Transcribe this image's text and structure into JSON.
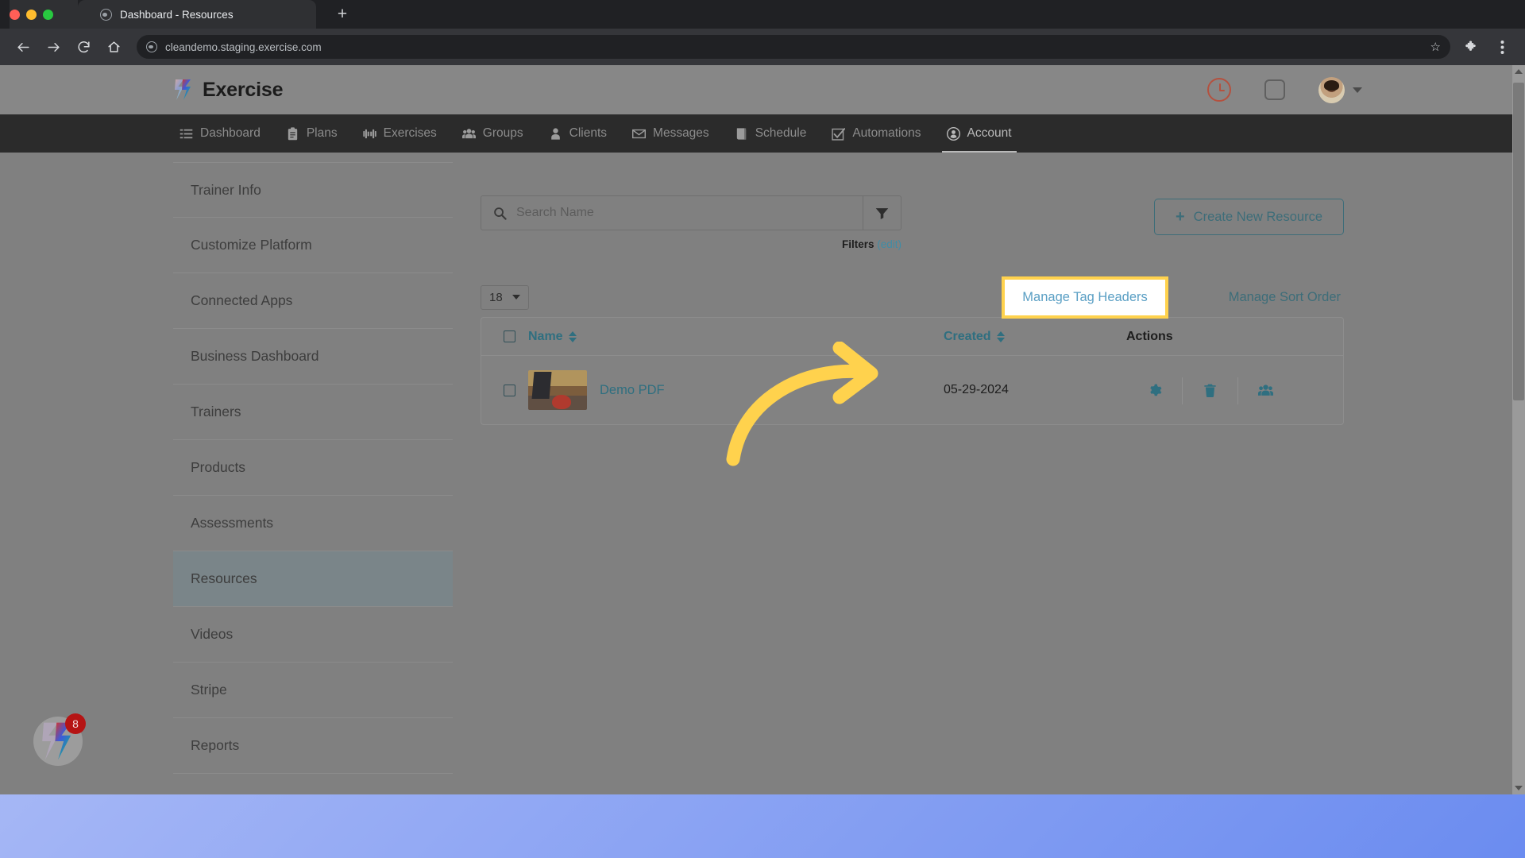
{
  "browser": {
    "tab": {
      "title": "Dashboard - Resources",
      "favicon_icon": "globe-icon"
    },
    "new_tab_label": "+",
    "back_icon": "back-arrow-icon",
    "forward_icon": "forward-arrow-icon",
    "reload_icon": "reload-icon",
    "home_icon": "home-icon",
    "url": "cleandemo.staging.exercise.com",
    "star_icon": "star-icon",
    "extensions_icon": "puzzle-piece-icon",
    "menu_icon": "three-dot-menu-icon"
  },
  "site_header": {
    "brand_name": "Exercise",
    "logo_icon": "chevron-logo-icon",
    "clock_icon": "clock-icon",
    "square_icon": "square-icon",
    "avatar_icon": "user-avatar",
    "caret_icon": "chevron-down-icon"
  },
  "main_nav": {
    "items": [
      {
        "label": "Dashboard",
        "icon": "list-icon",
        "active": false
      },
      {
        "label": "Plans",
        "icon": "clipboard-icon",
        "active": false
      },
      {
        "label": "Exercises",
        "icon": "dumbbell-icon",
        "active": false
      },
      {
        "label": "Groups",
        "icon": "people-icon",
        "active": false
      },
      {
        "label": "Clients",
        "icon": "person-icon",
        "active": false
      },
      {
        "label": "Messages",
        "icon": "envelope-icon",
        "active": false
      },
      {
        "label": "Schedule",
        "icon": "book-icon",
        "active": false
      },
      {
        "label": "Automations",
        "icon": "check-square-icon",
        "active": false
      },
      {
        "label": "Account",
        "icon": "user-circle-icon",
        "active": true
      }
    ]
  },
  "sidebar": {
    "items": [
      {
        "label": "Trainer Info",
        "active": false
      },
      {
        "label": "Customize Platform",
        "active": false
      },
      {
        "label": "Connected Apps",
        "active": false
      },
      {
        "label": "Business Dashboard",
        "active": false
      },
      {
        "label": "Trainers",
        "active": false
      },
      {
        "label": "Products",
        "active": false
      },
      {
        "label": "Assessments",
        "active": false
      },
      {
        "label": "Resources",
        "active": true
      },
      {
        "label": "Videos",
        "active": false
      },
      {
        "label": "Stripe",
        "active": false
      },
      {
        "label": "Reports",
        "active": false
      }
    ]
  },
  "main": {
    "search": {
      "placeholder": "Search Name",
      "value": "",
      "search_icon": "search-icon",
      "filter_icon": "funnel-icon"
    },
    "filters": {
      "label": "Filters",
      "edit_label": "(edit)"
    },
    "create_button": {
      "plus": "+",
      "label": "Create New Resource"
    },
    "page_size": {
      "value": "18",
      "caret_icon": "chevron-down-icon"
    },
    "manage_tag_headers": {
      "label": "Manage Tag Headers",
      "highlight_color": "#ffd24d"
    },
    "manage_sort_order": {
      "label": "Manage Sort Order"
    },
    "table": {
      "columns": [
        {
          "label": "Name",
          "sortable": true
        },
        {
          "label": "Created",
          "sortable": true
        },
        {
          "label": "Actions",
          "sortable": false
        }
      ],
      "rows": [
        {
          "name": "Demo PDF",
          "created": "05-29-2024",
          "thumbnail_icon": "resource-thumbnail",
          "actions": [
            {
              "icon": "gear-icon",
              "name": "settings"
            },
            {
              "icon": "trash-icon",
              "name": "delete"
            },
            {
              "icon": "people-icon",
              "name": "share"
            }
          ]
        }
      ]
    }
  },
  "annotation": {
    "arrow_icon": "curved-arrow-icon",
    "arrow_color": "#ffd24d"
  },
  "dock": {
    "app_icon": "exercise-app-icon",
    "badge_count": "8"
  },
  "colors": {
    "accent_teal": "#3d6d79",
    "link_blue": "#2f6f80",
    "highlight_yellow": "#ffd24d",
    "clock_red": "#b4513f",
    "badge_red": "#b51414"
  }
}
